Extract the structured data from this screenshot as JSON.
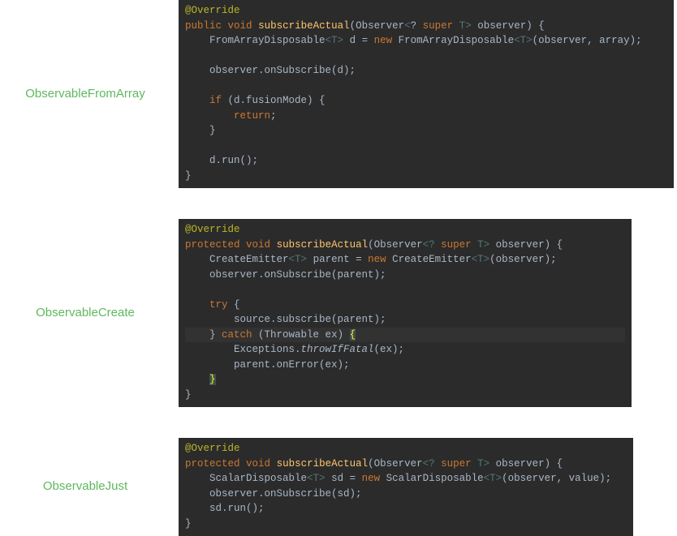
{
  "sections": {
    "fromArray": {
      "label": "ObservableFromArray",
      "code": {
        "l1_anno": "@Override",
        "l2a_kw1": "public",
        "l2a_kw2": "void",
        "l2a_fn": "subscribeActual",
        "l2a_paramTy": "Observer",
        "l2a_genOpen": "<",
        "l2a_q": "?",
        "l2a_kw3": "super",
        "l2a_genTy": "T",
        "l2a_genClose": ">",
        "l2a_paramName": " observer) {",
        "l3_ty": "FromArrayDisposable",
        "l3_gen": "<T>",
        "l3_var": " d = ",
        "l3_new": "new",
        "l3_ctor": " FromArrayDisposable",
        "l3_gen2": "<T>",
        "l3_args": "(observer, array);",
        "l5": "observer.onSubscribe(d);",
        "l7_if": "if",
        "l7_rest": " (d.fusionMode) {",
        "l8_ret": "return",
        "l8_semi": ";",
        "l9": "}",
        "l11": "d.run();",
        "l12": "}"
      }
    },
    "create": {
      "label": "ObservableCreate",
      "code": {
        "l1_anno": "@Override",
        "l2_kw1": "protected",
        "l2_kw2": "void",
        "l2_fn": "subscribeActual",
        "l2_paramTy": "Observer",
        "l2_gen": "<? ",
        "l2_kw3": "super",
        "l2_gen2": " T>",
        "l2_rest": " observer) {",
        "l3_ty": "CreateEmitter",
        "l3_gen": "<T>",
        "l3_mid": " parent = ",
        "l3_new": "new",
        "l3_ctor": " CreateEmitter",
        "l3_gen2": "<T>",
        "l3_args": "(observer);",
        "l4": "observer.onSubscribe(parent);",
        "l6_try": "try",
        "l6_br": " {",
        "l7": "source.subscribe(parent);",
        "l8a": "} ",
        "l8_catch": "catch",
        "l8b": " (Throwable ex) ",
        "l8_brace": "{",
        "l9a": "Exceptions.",
        "l9_st": "throwIfFatal",
        "l9b": "(ex);",
        "l10": "parent.onError(ex);",
        "l11_brace": "}",
        "l12": "}"
      }
    },
    "just": {
      "label": "ObservableJust",
      "code": {
        "l1_anno": "@Override",
        "l2_kw1": "protected",
        "l2_kw2": "void",
        "l2_fn": "subscribeActual",
        "l2_paramTy": "Observer",
        "l2_gen": "<? ",
        "l2_kw3": "super",
        "l2_gen2": " T>",
        "l2_rest": " observer) {",
        "l3_ty": "ScalarDisposable",
        "l3_gen": "<T>",
        "l3_mid": " sd = ",
        "l3_new": "new",
        "l3_ctor": " ScalarDisposable",
        "l3_gen2": "<T>",
        "l3_args": "(observer, value);",
        "l4": "observer.onSubscribe(sd);",
        "l5": "sd.run();",
        "l6": "}"
      }
    }
  }
}
